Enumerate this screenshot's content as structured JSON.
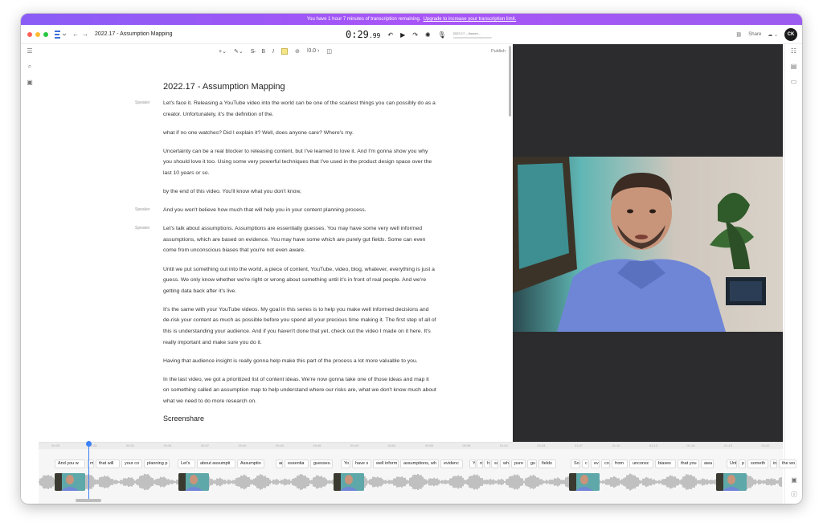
{
  "banner": {
    "text": "You have 1 hour 7 minutes of transcription remaining.",
    "link": "Upgrade to increase your transcription limit."
  },
  "titlebar": {
    "doc_name": "2022.17 - Assumption Mapping",
    "timer_main": "0:29",
    "timer_ms": ".99",
    "mini_track_label": "2022.17 – Assum...",
    "share": "Share",
    "avatar": "CK"
  },
  "toolbar": {
    "zoom": "0.0",
    "publish": "Publish"
  },
  "doc": {
    "title": "2022.17 - Assumption Mapping",
    "speaker_label": "Speaker",
    "playhead_time": "00:29",
    "paragraphs": [
      {
        "speaker": true,
        "text": "Let's face it. Releasing a YouTube video into the world can be one of the scariest things you can possibly do as a creator. Unfortunately, it's the definition of the."
      },
      {
        "speaker": false,
        "text": "what if no one watches? Did I explain it? Well, does anyone care? Where's my."
      },
      {
        "speaker": false,
        "text": "Uncertainty can be a real blocker to releasing content, but I've learned to love it. And I'm gonna show you why you should love it too. Using some very powerful techniques that I've used in the product design space over the last 10 years or so."
      },
      {
        "speaker": false,
        "text": "by the end of this video. You'll know what you don't know,"
      },
      {
        "speaker": true,
        "text": "And you won't believe how much that will help you in your content planning process."
      },
      {
        "speaker": true,
        "text": "Let's talk about assumptions. Assumptions are essentially guesses. You may have some very well informed assumptions, which are based on evidence. You may have some which are purely gut fields. Some can even come from unconscious biases that you're not even aware."
      },
      {
        "speaker": false,
        "text": "Until we put something out into the world, a piece of content, YouTube, video, blog, whatever, everything is just a guess. We only know whether we're right or wrong about something until it's in front of real people. And we're getting data back after it's live."
      },
      {
        "speaker": false,
        "text": "It's the same with your YouTube videos. My goal in this series is to help you make well informed decisions and de-risk your content as much as possible before you spend all your precious time making it. The first step of all of this is understanding your audience. And if you haven't done that yet, check out the video I made on it here. It's really important and make sure you do it."
      },
      {
        "speaker": false,
        "text": "Having that audience insight is really gonna help make this part of the process a lot more valuable to you."
      },
      {
        "speaker": false,
        "text": "In the last video, we got a prioritized list of content ideas. We're now gonna take one of those ideas and map it on something called an assumption map to help understand where our risks are, what we don't know much about what we need to do more research on."
      }
    ],
    "section_heading": "Screenshare"
  },
  "timeline": {
    "ticks": [
      "00:25",
      "00:28",
      "00:31",
      "00:34",
      "00:37",
      "00:40",
      "00:43",
      "00:46",
      "00:49",
      "00:52",
      "00:55",
      "00:58",
      "01:01",
      "01:04",
      "01:07",
      "01:10",
      "01:13",
      "01:16",
      "01:19",
      "01:22"
    ],
    "words": [
      "And you w",
      "m",
      "that will",
      "your co",
      "planning p",
      "Let's",
      "about assumpti",
      "Assumptio",
      "ar",
      "essentia",
      "guesses.",
      "Yo",
      "have s",
      "well inform",
      "assumptions, wh",
      "evidenc",
      "Y",
      "m",
      "h",
      "so",
      "wh",
      "pure",
      "gu",
      "fields",
      "So",
      "c",
      "ev",
      "co",
      "from",
      "unconsc",
      "biases",
      "that you",
      "awa",
      "Unt",
      "p",
      "someth",
      "in",
      "the wo"
    ]
  },
  "colors": {
    "accent": "#3b82f6",
    "banner": "#9b5cf0",
    "video_bg": "#2c2c2e"
  }
}
